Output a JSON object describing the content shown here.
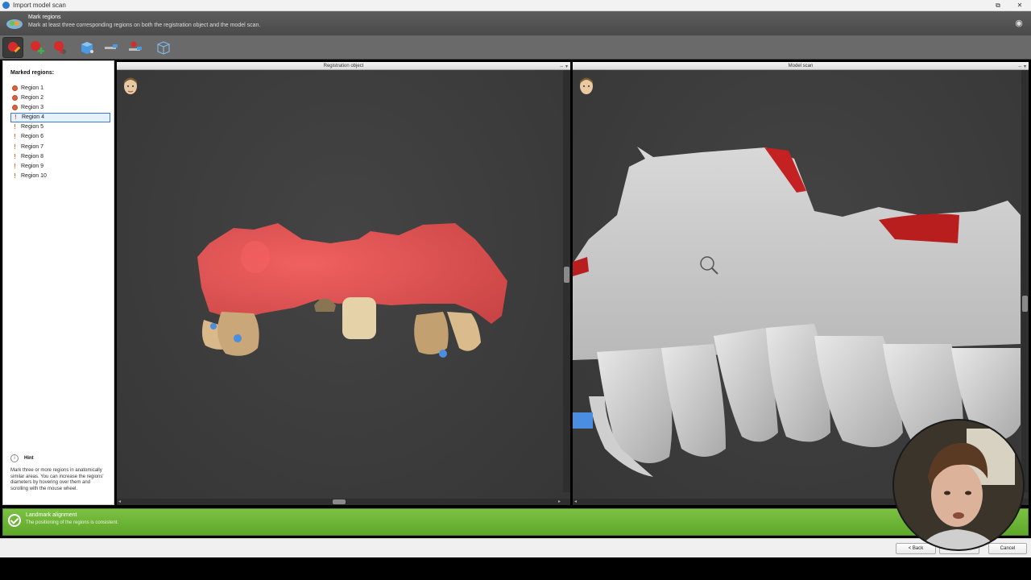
{
  "window": {
    "title": "Import model scan"
  },
  "header": {
    "title": "Mark regions",
    "subtitle": "Mark at least three corresponding regions on both the registration object and the model scan."
  },
  "toolbar": {
    "tools": [
      "mark-region-icon",
      "add-region-icon",
      "remove-region-icon",
      "view-cube-icon",
      "tool-icon",
      "reset-icon",
      "wireframe-cube-icon"
    ]
  },
  "left_panel": {
    "title": "Marked regions:",
    "regions": [
      {
        "label": "Region 1",
        "status": "marked"
      },
      {
        "label": "Region 2",
        "status": "marked"
      },
      {
        "label": "Region 3",
        "status": "marked"
      },
      {
        "label": "Region 4",
        "status": "pending",
        "selected": true
      },
      {
        "label": "Region 5",
        "status": "pending"
      },
      {
        "label": "Region 6",
        "status": "pending"
      },
      {
        "label": "Region 7",
        "status": "pending"
      },
      {
        "label": "Region 8",
        "status": "pending"
      },
      {
        "label": "Region 9",
        "status": "pending"
      },
      {
        "label": "Region 10",
        "status": "pending"
      }
    ],
    "hint_title": "Hint",
    "hint_text": "Mark three or more regions in anatomically similar areas. You can increase the regions' diameters by hovering over them and scrolling with the mouse wheel."
  },
  "viewports": {
    "left_title": "Registration object",
    "right_title": "Model scan"
  },
  "status": {
    "title": "Landmark alignment",
    "text": "The positioning of the regions is consistent.",
    "color": "#6db536"
  },
  "footer": {
    "back_label": "< Back",
    "cancel_label": "Cancel"
  },
  "colors": {
    "accent": "#3a7bd5",
    "region_marker": "#e0603a",
    "success": "#6db536"
  }
}
